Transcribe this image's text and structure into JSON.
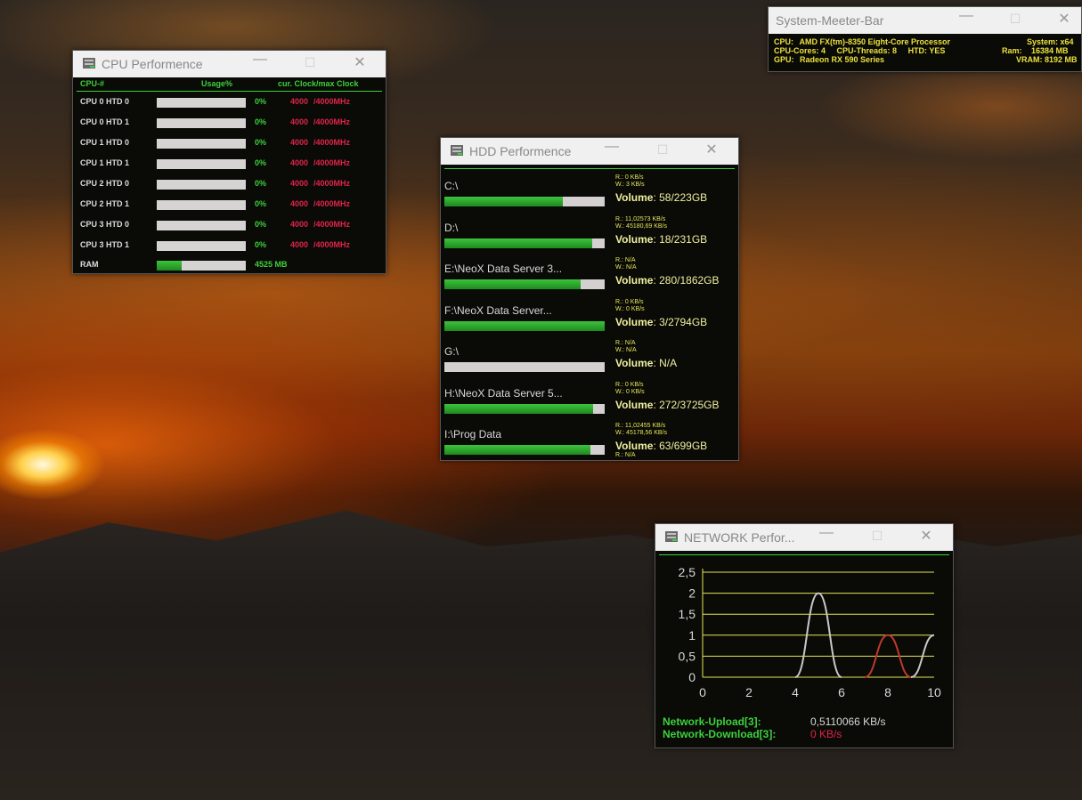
{
  "desktop": {
    "wallpaper": "sunset-landscape"
  },
  "colors": {
    "green": "#3cd23c",
    "red": "#e0254a",
    "yellow": "#ebe13c",
    "window_bg": "#0a0a07"
  },
  "system_bar": {
    "title": "System-Meeter-Bar",
    "cpu_label": "CPU:",
    "cpu_value": "AMD FX(tm)-8350 Eight-Core Processor",
    "system_label": "System: x64",
    "cores_label": "CPU-Cores: 4",
    "threads_label": "CPU-Threads: 8",
    "htd_label": "HTD: YES",
    "ram_label": "Ram:",
    "ram_value": "16384 MB",
    "gpu_label": "GPU:",
    "gpu_value": "Radeon RX 590 Series",
    "vram_label": "VRAM: 8192 MB"
  },
  "cpu_window": {
    "title": "CPU Performence",
    "col_cpu": "CPU-#",
    "col_usage": "Usage%",
    "col_clock": "cur. Clock/max Clock",
    "rows": [
      {
        "name": "CPU 0  HTD 0",
        "usage": "0%",
        "cur": "4000",
        "max": "/4000MHz",
        "fill": 0
      },
      {
        "name": "CPU 0  HTD 1",
        "usage": "0%",
        "cur": "4000",
        "max": "/4000MHz",
        "fill": 0
      },
      {
        "name": "CPU 1  HTD 0",
        "usage": "0%",
        "cur": "4000",
        "max": "/4000MHz",
        "fill": 0
      },
      {
        "name": "CPU 1  HTD 1",
        "usage": "0%",
        "cur": "4000",
        "max": "/4000MHz",
        "fill": 0
      },
      {
        "name": "CPU 2  HTD 0",
        "usage": "0%",
        "cur": "4000",
        "max": "/4000MHz",
        "fill": 0
      },
      {
        "name": "CPU 2  HTD 1",
        "usage": "0%",
        "cur": "4000",
        "max": "/4000MHz",
        "fill": 0
      },
      {
        "name": "CPU 3  HTD 0",
        "usage": "0%",
        "cur": "4000",
        "max": "/4000MHz",
        "fill": 0
      },
      {
        "name": "CPU 3  HTD 1",
        "usage": "0%",
        "cur": "4000",
        "max": "/4000MHz",
        "fill": 0
      }
    ],
    "ram_label": "RAM",
    "ram_value": "4525 MB",
    "ram_fill": 0.28
  },
  "hdd_window": {
    "title": "HDD Performence",
    "drives": [
      {
        "name": "C:\\",
        "r": "R.: 0 KB/s",
        "w": "W.: 3 KB/s",
        "vol_label": "Volume",
        "vol": ": 58/223GB",
        "fill": 0.74
      },
      {
        "name": "D:\\",
        "r": "R.: 11,02573 KB/s",
        "w": "W.: 45180,69 KB/s",
        "vol_label": "Volume",
        "vol": ": 18/231GB",
        "fill": 0.92
      },
      {
        "name": "E:\\NeoX Data Server 3...",
        "r": "R.: N/A",
        "w": "W.: N/A",
        "vol_label": "Volume",
        "vol": ": 280/1862GB",
        "fill": 0.85
      },
      {
        "name": "F:\\NeoX Data Server...",
        "r": "R.: 0 KB/s",
        "w": "W.: 0 KB/s",
        "vol_label": "Volume",
        "vol": ": 3/2794GB",
        "fill": 0.999
      },
      {
        "name": "G:\\",
        "r": "R.: N/A",
        "w": "W.: N/A",
        "vol_label": "Volume",
        "vol": ": N/A",
        "fill": 0
      },
      {
        "name": "H:\\NeoX Data Server 5...",
        "r": "R.: 0 KB/s",
        "w": "W.: 0 KB/s",
        "vol_label": "Volume",
        "vol": ": 272/3725GB",
        "fill": 0.93
      },
      {
        "name": "I:\\Prog  Data",
        "r": "R.: 11,02455 KB/s",
        "w": "W.: 45178,56 KB/s",
        "vol_label": "Volume",
        "vol": ": 63/699GB",
        "fill": 0.91
      }
    ],
    "trailing_r": "R.: N/A"
  },
  "network_window": {
    "title": "NETWORK Perfor...",
    "upload_label": "Network-Upload[3]:",
    "upload_value": "0,5110066 KB/s",
    "download_label": "Network-Download[3]:",
    "download_value": "0 KB/s",
    "chart_data": {
      "type": "line",
      "xlim": [
        0,
        10
      ],
      "ylim": [
        0,
        2.5
      ],
      "x_ticks": [
        "0",
        "2",
        "4",
        "6",
        "8",
        "10"
      ],
      "y_ticks": [
        "0",
        "0,5",
        "1",
        "1,5",
        "2",
        "2,5"
      ],
      "grid": true,
      "series": [
        {
          "color": "#c8c8c8",
          "points": [
            [
              4,
              0
            ],
            [
              5,
              2
            ],
            [
              6,
              0
            ]
          ]
        },
        {
          "color": "#c0392b",
          "points": [
            [
              7,
              0
            ],
            [
              8,
              1
            ],
            [
              9,
              0
            ]
          ]
        },
        {
          "color": "#c8c8c8",
          "points": [
            [
              9,
              0
            ],
            [
              10,
              1
            ]
          ]
        }
      ]
    }
  }
}
